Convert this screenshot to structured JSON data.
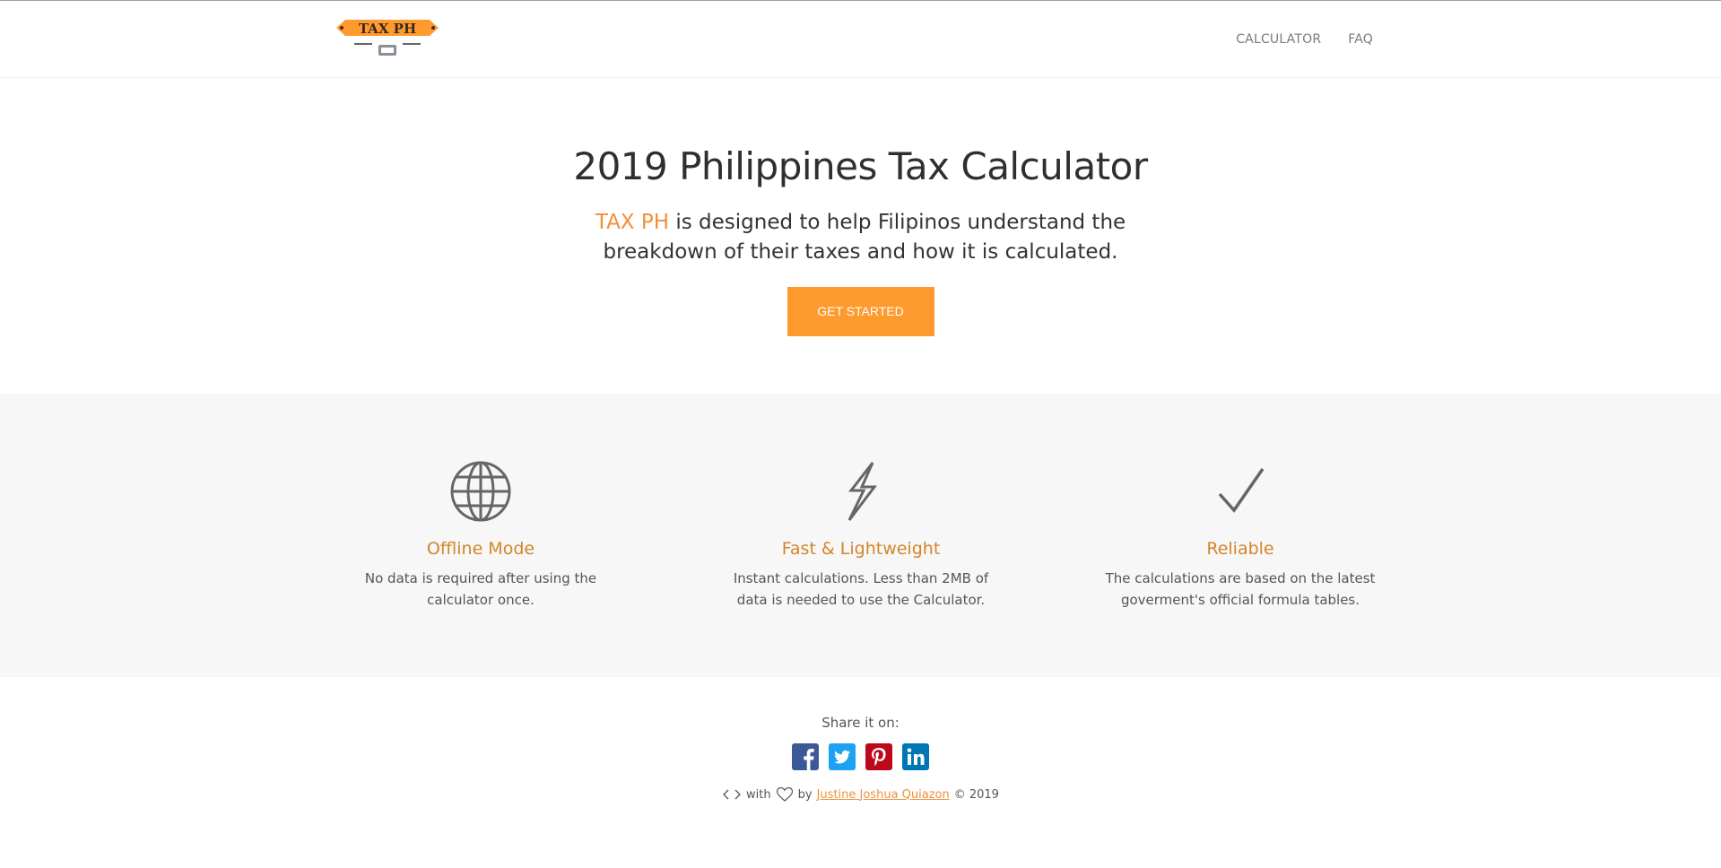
{
  "header": {
    "logo_text": "TAX PH",
    "nav": [
      {
        "label": "CALCULATOR"
      },
      {
        "label": "FAQ"
      }
    ]
  },
  "hero": {
    "title": "2019 Philippines Tax Calculator",
    "brand": "TAX PH",
    "lead": " is designed to help Filipinos understand the breakdown of their taxes and how it is calculated.",
    "cta_label": "GET STARTED"
  },
  "features": [
    {
      "icon": "globe-icon",
      "title": "Offline Mode",
      "text": "No data is required after using the calculator once."
    },
    {
      "icon": "lightning-icon",
      "title": "Fast & Lightweight",
      "text": "Instant calculations. Less than 2MB of data is needed to use the Calculator."
    },
    {
      "icon": "checkmark-icon",
      "title": "Reliable",
      "text": "The calculations are based on the latest goverment's official formula tables."
    }
  ],
  "footer": {
    "share_label": "Share it on:",
    "social": [
      "facebook-icon",
      "twitter-icon",
      "pinterest-icon",
      "linkedin-icon"
    ],
    "credit_with": "with",
    "credit_by": "by",
    "author": "Justine Joshua Quiazon",
    "copyright": "© 2019"
  },
  "colors": {
    "accent": "#ff9a2e",
    "accent_text": "#d3852a",
    "facebook": "#3b5998",
    "twitter": "#1da1f2",
    "pinterest": "#bd081c",
    "linkedin": "#0077b5"
  }
}
